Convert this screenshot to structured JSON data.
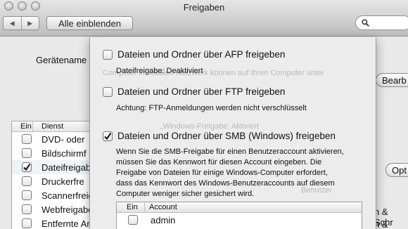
{
  "window": {
    "title": "Freigaben"
  },
  "toolbar": {
    "show_all": "Alle einblenden",
    "back_glyph": "◀",
    "forward_glyph": "▶"
  },
  "background": {
    "computer_name_label": "Gerätename",
    "edit_button": "Bearb",
    "options_button": "Opt",
    "ghost_lines": [
      "Computer im lokalen Netzwerk können auf Ihren Computer unter",
      "„Windows-Freigabe: Aktiviert",
      "Benutzer"
    ],
    "users_right": [
      "n & Schr",
      "n & Schr"
    ],
    "table": {
      "col_ein": "Ein",
      "col_dienst": "Dienst",
      "rows": [
        {
          "label": "DVD- oder",
          "checked": false
        },
        {
          "label": "Bildschirmf",
          "checked": false
        },
        {
          "label": "Dateifreigabe",
          "checked": true
        },
        {
          "label": "Druckerfre",
          "checked": false
        },
        {
          "label": "Scannerfreig",
          "checked": false
        },
        {
          "label": "Webfreigabe",
          "checked": false
        },
        {
          "label": "Entfernte An",
          "checked": false
        }
      ]
    }
  },
  "sheet": {
    "afp": {
      "label": "Dateien und Ordner über AFP freigeben",
      "checked": false,
      "note": "Dateifreigabe: Deaktiviert"
    },
    "ftp": {
      "label": "Dateien und Ordner über FTP freigeben",
      "checked": false,
      "note": "Achtung: FTP-Anmeldungen werden nicht verschlüsselt"
    },
    "smb": {
      "label": "Dateien und Ordner über SMB (Windows) freigeben",
      "checked": true,
      "note_lines": [
        "Wenn Sie die SMB-Freigabe für einen Benutzeraccount aktivieren,",
        "müssen Sie das Kennwort für diesen Account eingeben. Die",
        "Freigabe von Dateien für einige Windows-Computer erfordert,",
        "dass das Kennwort des Windows-Benutzeraccounts auf diesem",
        "Computer weniger sicher gesichert wird."
      ]
    },
    "accounts": {
      "col_ein": "Ein",
      "col_account": "Account",
      "rows": [
        {
          "name": "admin",
          "checked": false
        }
      ]
    }
  }
}
